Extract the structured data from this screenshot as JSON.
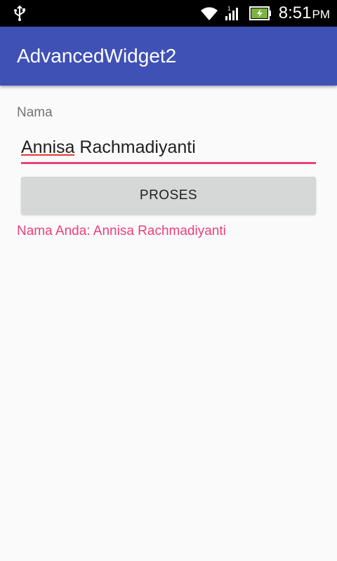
{
  "status_bar": {
    "time": "8:51",
    "ampm": "PM",
    "icons": [
      "usb-icon",
      "wifi-icon",
      "signal-icon",
      "battery-charging-icon"
    ],
    "signal_sim": "1"
  },
  "app_bar": {
    "title": "AdvancedWidget2",
    "color": "#3f51b5"
  },
  "form": {
    "label": "Nama",
    "input": {
      "value_first": "Annisa",
      "value_rest": " Rachmadiyanti",
      "underline_color": "#ec407a"
    },
    "button_label": "PROSES",
    "result": "Nama Anda: Annisa Rachmadiyanti",
    "result_color": "#ec407a"
  }
}
